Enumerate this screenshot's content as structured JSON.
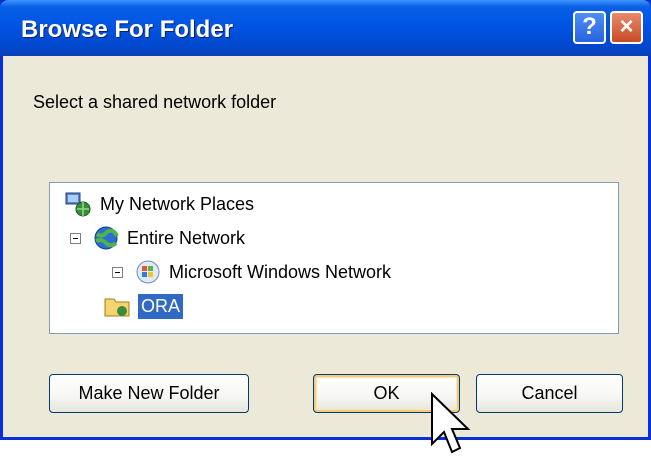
{
  "window": {
    "title": "Browse For Folder",
    "help_glyph": "?",
    "close_glyph": "×"
  },
  "dialog": {
    "prompt": "Select a shared network folder"
  },
  "tree": {
    "items": [
      {
        "label": "My Network Places",
        "icon": "network-places-icon",
        "expanded": true,
        "selected": false
      },
      {
        "label": "Entire Network",
        "icon": "globe-icon",
        "expanded": true,
        "selected": false
      },
      {
        "label": "Microsoft Windows Network",
        "icon": "windows-network-icon",
        "expanded": true,
        "selected": false
      },
      {
        "label": "ORA",
        "icon": "workgroup-icon",
        "expanded": false,
        "selected": true
      }
    ]
  },
  "buttons": {
    "make_new_folder": "Make New Folder",
    "ok": "OK",
    "cancel": "Cancel"
  },
  "colors": {
    "title_bar": "#0054e3",
    "selection": "#316ac5",
    "dialog_bg": "#ece9d8"
  }
}
